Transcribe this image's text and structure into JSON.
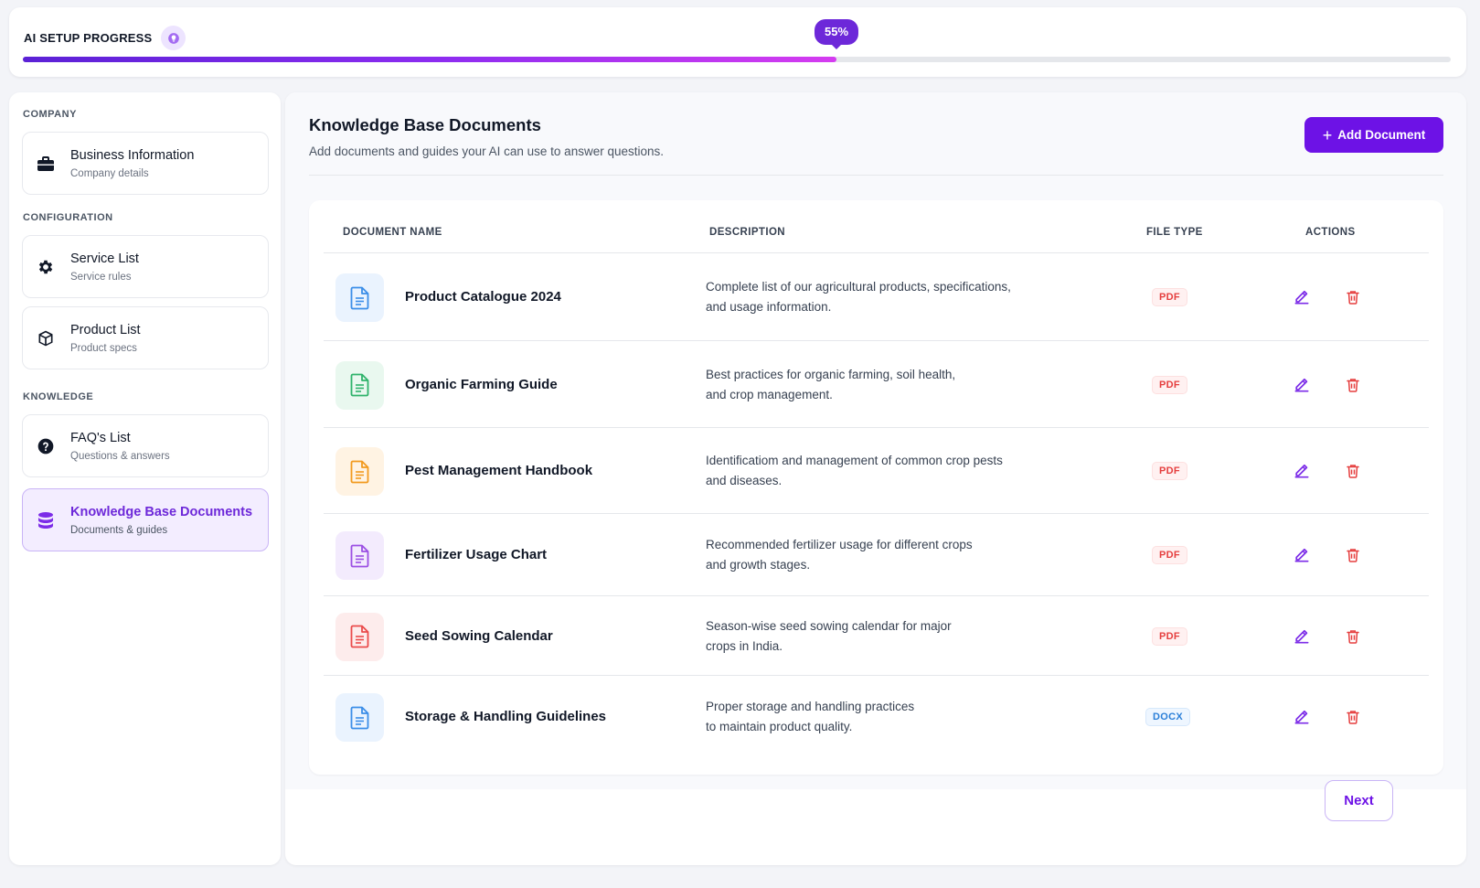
{
  "progress": {
    "title": "AI SETUP PROGRESS",
    "percent_label": "55%",
    "percent": 0.57
  },
  "sidebar": {
    "sections": [
      {
        "label": "COMPANY"
      },
      {
        "label": "CONFIGURATION"
      },
      {
        "label": "KNOWLEDGE"
      }
    ],
    "items": [
      {
        "title": "Business Information",
        "subtitle": "Company details",
        "icon": "briefcase-icon"
      },
      {
        "title": "Service List",
        "subtitle": "Service rules",
        "icon": "gear-icon"
      },
      {
        "title": "Product List",
        "subtitle": "Product specs",
        "icon": "package-icon"
      },
      {
        "title": "FAQ's List",
        "subtitle": "Questions & answers",
        "icon": "question-icon"
      },
      {
        "title": "Knowledge Base Documents",
        "subtitle": "Documents & guides",
        "icon": "database-icon",
        "active": true
      }
    ]
  },
  "main": {
    "title": "Knowledge Base Documents",
    "subtitle": "Add documents and guides your AI can use to answer questions.",
    "add_button": "Add Document",
    "next_button": "Next"
  },
  "table": {
    "headers": {
      "name": "DOCUMENT NAME",
      "description": "DESCRIPTION",
      "file_type": "FILE TYPE",
      "actions": "ACTIONS"
    },
    "rows": [
      {
        "name": "Product Catalogue 2024",
        "desc1": "Complete list of our agricultural products, specifications,",
        "desc2": "and usage information.",
        "type": "PDF",
        "icon_color": "#3b8ee8",
        "icon_bg": "#eaf3fe"
      },
      {
        "name": "Organic Farming Guide",
        "desc1": "Best practices for organic farming, soil health,",
        "desc2": "and crop management.",
        "type": "PDF",
        "icon_color": "#2fb36b",
        "icon_bg": "#e9f8ef"
      },
      {
        "name": "Pest Management Handbook",
        "desc1": "Identificatiom and management of common crop pests",
        "desc2": "and diseases.",
        "type": "PDF",
        "icon_color": "#f29a1f",
        "icon_bg": "#fff3e3"
      },
      {
        "name": "Fertilizer Usage Chart",
        "desc1": "Recommended fertilizer usage for different crops",
        "desc2": "and growth stages.",
        "type": "PDF",
        "icon_color": "#9b4fe3",
        "icon_bg": "#f3ebfd"
      },
      {
        "name": "Seed Sowing Calendar",
        "desc1": "Season-wise seed sowing calendar for major",
        "desc2": "crops in India.",
        "type": "PDF",
        "icon_color": "#ea4b4b",
        "icon_bg": "#fdecec"
      },
      {
        "name": "Storage & Handling Guidelines",
        "desc1": "Proper storage and handling practices",
        "desc2": "to maintain product quality.",
        "type": "DOCX",
        "icon_color": "#3b8ee8",
        "icon_bg": "#eaf3fe"
      }
    ]
  },
  "colors": {
    "accent": "#6d12e6",
    "danger": "#e53e3e",
    "edit": "#7c2ce8"
  }
}
